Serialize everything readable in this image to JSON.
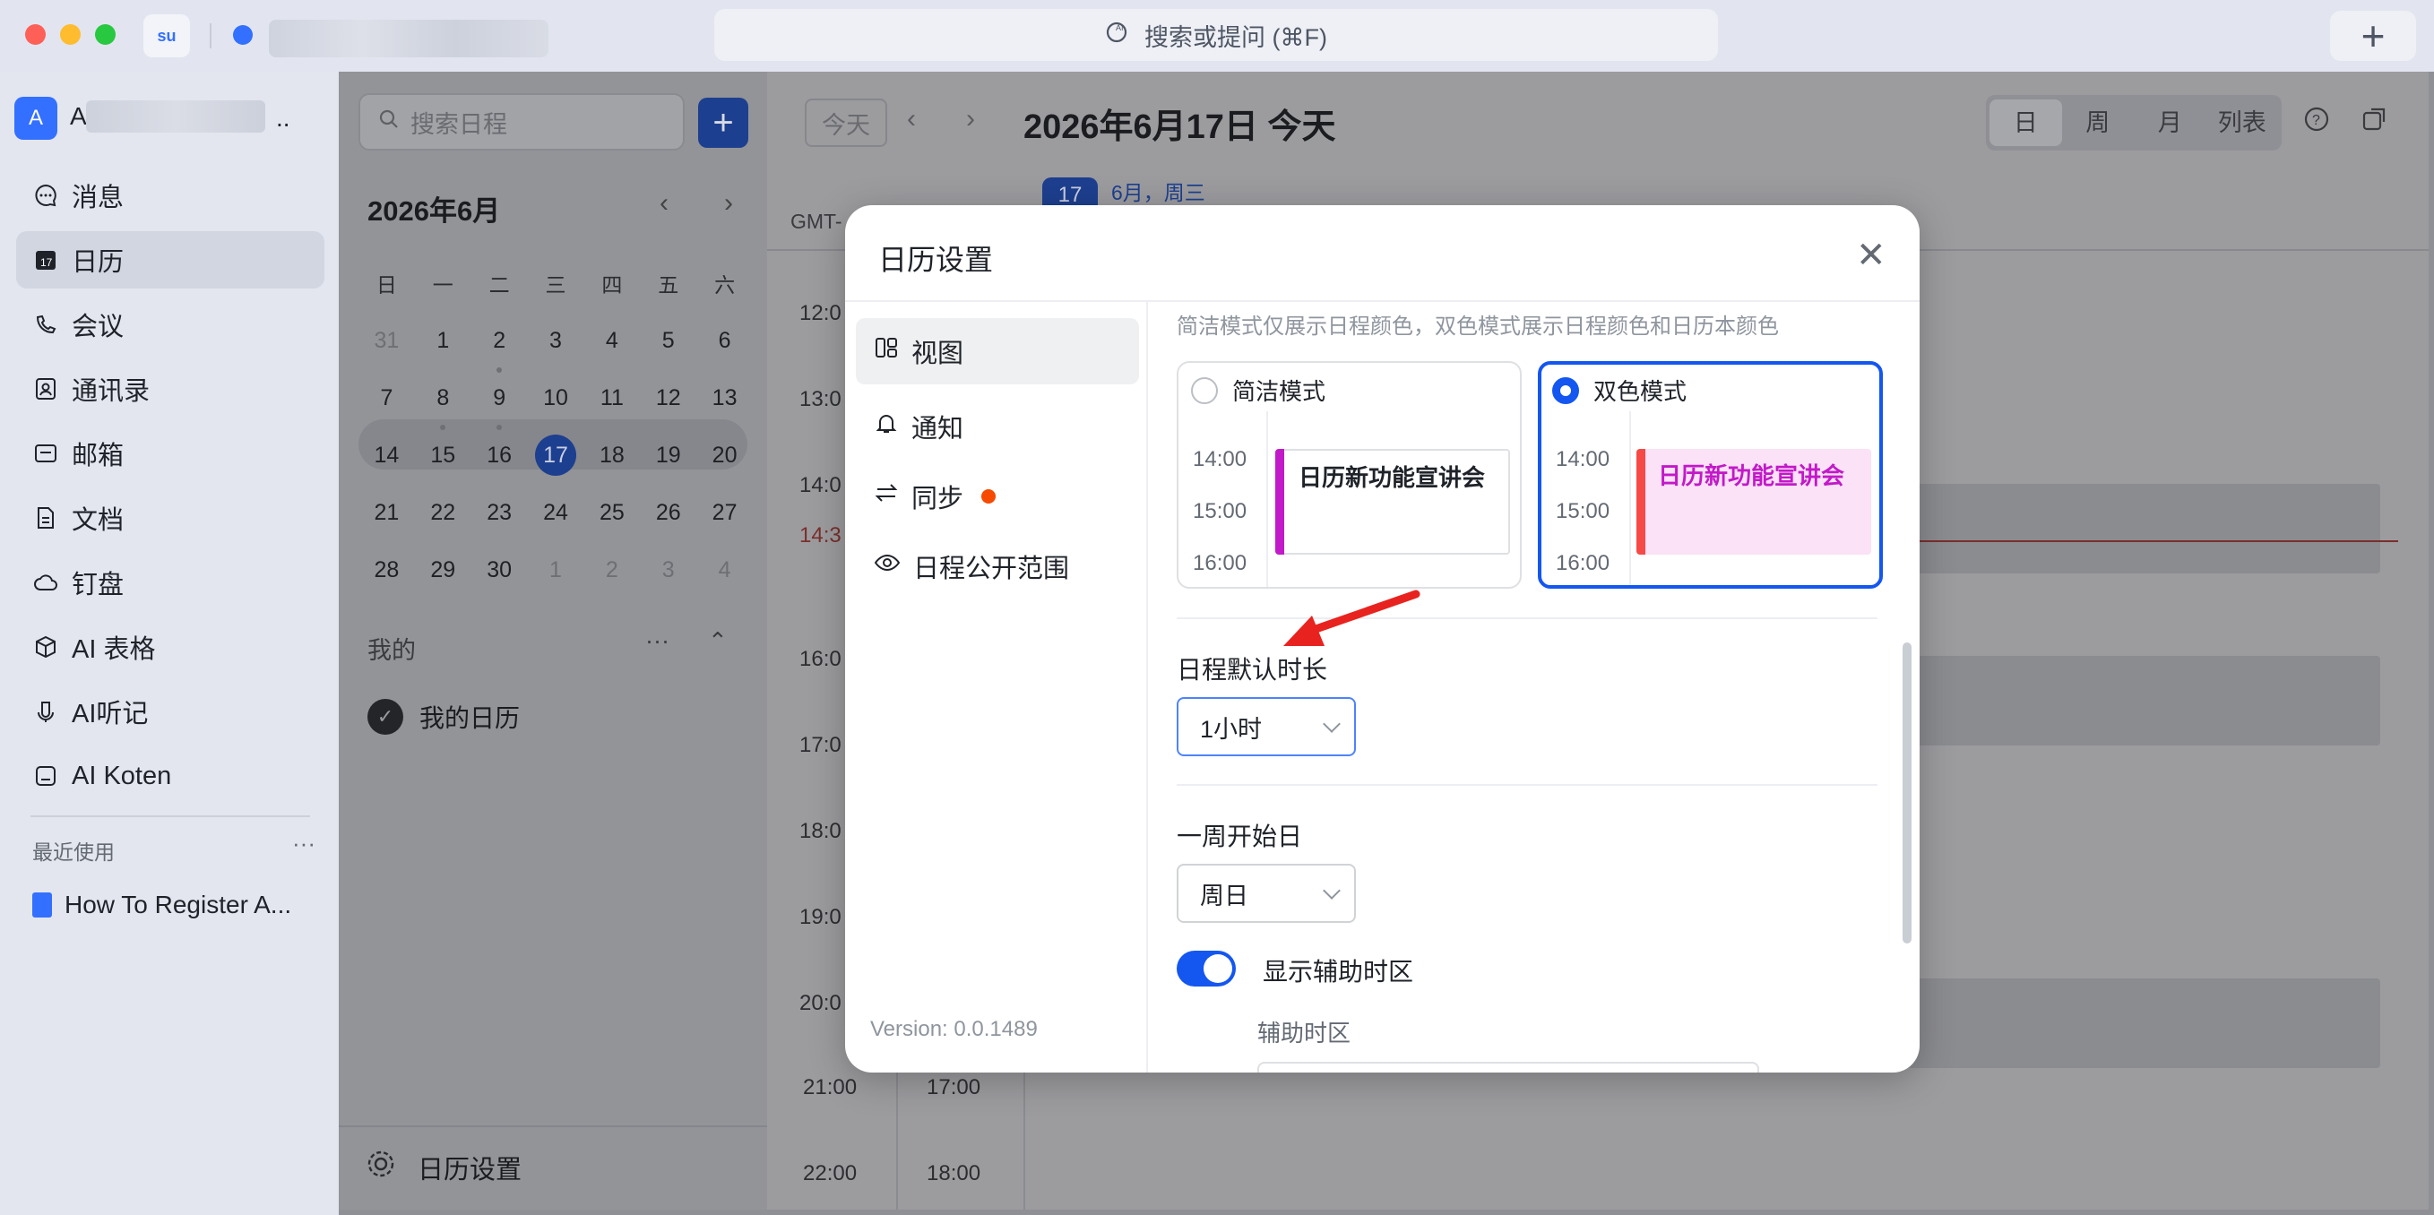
{
  "titlebar": {
    "app_badge": "su",
    "search_placeholder": "搜索或提问 (⌘F)",
    "new_tab": "+"
  },
  "account": {
    "avatar": "A",
    "name_prefix": "A",
    "name_suffix": ".."
  },
  "nav": {
    "items": [
      {
        "label": "消息",
        "icon": "message-icon"
      },
      {
        "label": "日历",
        "icon": "calendar-icon",
        "active": true
      },
      {
        "label": "会议",
        "icon": "meeting-icon"
      },
      {
        "label": "通讯录",
        "icon": "contacts-icon"
      },
      {
        "label": "邮箱",
        "icon": "mail-icon"
      },
      {
        "label": "文档",
        "icon": "docs-icon"
      },
      {
        "label": "钉盘",
        "icon": "cloud-drive-icon"
      },
      {
        "label": "AI 表格",
        "icon": "ai-table-icon"
      },
      {
        "label": "AI听记",
        "icon": "ai-notes-icon"
      },
      {
        "label": "AI Koten",
        "icon": "ai-koten-icon"
      }
    ],
    "recent_label": "最近使用",
    "recent_more": "···",
    "recent_items": [
      {
        "label": "How To Register A...",
        "icon": "doc-icon"
      }
    ]
  },
  "calendar_panel": {
    "search_placeholder": "搜索日程",
    "add": "+",
    "month_title": "2026年6月",
    "weekdays": [
      "日",
      "一",
      "二",
      "三",
      "四",
      "五",
      "六"
    ],
    "weeks": [
      [
        "31",
        "1",
        "2",
        "3",
        "4",
        "5",
        "6"
      ],
      [
        "7",
        "8",
        "9",
        "10",
        "11",
        "12",
        "13"
      ],
      [
        "14",
        "15",
        "16",
        "17",
        "18",
        "19",
        "20"
      ],
      [
        "21",
        "22",
        "23",
        "24",
        "25",
        "26",
        "27"
      ],
      [
        "28",
        "29",
        "30",
        "1",
        "2",
        "3",
        "4"
      ]
    ],
    "today": "17",
    "my_label": "我的",
    "my_more": "···",
    "my_calendar": "我的日历",
    "settings_link": "日历设置"
  },
  "calendar_main": {
    "today_button": "今天",
    "date_title": "2026年6月17日 今天",
    "views": [
      "日",
      "周",
      "月",
      "列表"
    ],
    "active_view": "日",
    "badge_day": "17",
    "badge_sub": "6月，周三",
    "gmt": "GMT-",
    "times_left": [
      "12:0",
      "13:0",
      "14:0",
      "14:3",
      "16:0",
      "17:0",
      "18:0",
      "19:0",
      "20:0",
      "21:00",
      "22:00"
    ],
    "times_right": [
      "17:00",
      "18:00"
    ]
  },
  "modal": {
    "title": "日历设置",
    "close": "✕",
    "menu": [
      {
        "label": "视图",
        "icon": "view-icon",
        "active": true
      },
      {
        "label": "通知",
        "icon": "bell-icon"
      },
      {
        "label": "同步",
        "icon": "sync-icon",
        "dot": true
      },
      {
        "label": "日程公开范围",
        "icon": "eye-icon"
      }
    ],
    "version": "Version: 0.0.1489",
    "mode_desc": "简洁模式仅展示日程颜色，双色模式展示日程颜色和日历本颜色",
    "modes": [
      {
        "label": "简洁模式",
        "selected": false,
        "event": "日历新功能宣讲会",
        "bar_color": "#c219c9",
        "text_color": "#1f2329",
        "bg": "#ffffff"
      },
      {
        "label": "双色模式",
        "selected": true,
        "event": "日历新功能宣讲会",
        "bar_color": "#f54a45",
        "text_color": "#c219c9",
        "bg": "#fbe2f6"
      }
    ],
    "mode_times": [
      "14:00",
      "15:00",
      "16:00"
    ],
    "default_duration_label": "日程默认时长",
    "default_duration_value": "1小时",
    "week_start_label": "一周开始日",
    "week_start_value": "周日",
    "aux_tz_toggle_label": "显示辅助时区",
    "aux_tz_label": "辅助时区"
  },
  "colors": {
    "accent": "#1456f0",
    "annotation_arrow": "#e8231f"
  }
}
